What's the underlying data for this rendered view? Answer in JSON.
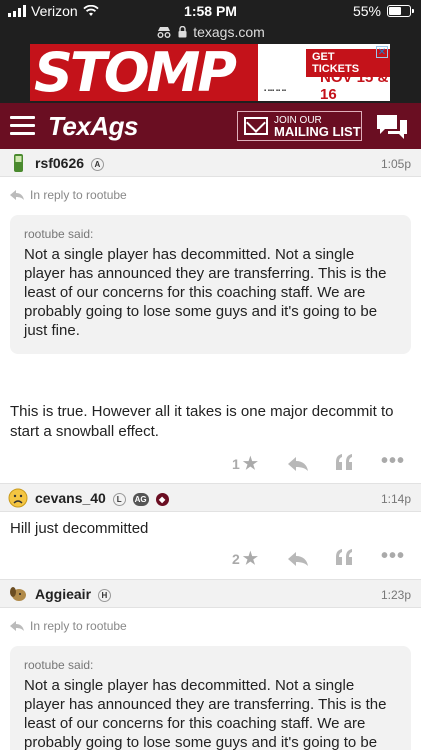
{
  "status_bar": {
    "carrier": "Verizon",
    "time": "1:58 PM",
    "battery_percent": "55%",
    "battery_level": 0.55
  },
  "url_bar": {
    "url": "texags.com"
  },
  "ad": {
    "headline": "STOMP",
    "button_label": "GET TICKETS",
    "dates": "NOV 15 & 16"
  },
  "header": {
    "logo": "TexAgs",
    "mail_small": "JOIN OUR",
    "mail_big": "MAILING LIST",
    "colors": {
      "maroon": "#6a0e22"
    }
  },
  "posts": [
    {
      "username": "rsf0626",
      "badges": [
        "A"
      ],
      "time": "1:05p",
      "reply_to": "In reply to rootube",
      "quote_author": "rootube said:",
      "quote_text": "Not a single player has decommitted. Not a single player has announced they are transferring. This is the least of our concerns for this coaching staff. We are probably going to lose some guys and it's going to be just fine.",
      "body": "This is true. However all it takes is one major decommit to start a snowball effect.",
      "stars": "1"
    },
    {
      "username": "cevans_40",
      "badges": [
        "L",
        "AG"
      ],
      "time": "1:14p",
      "body": "Hill just decommitted",
      "stars": "2"
    },
    {
      "username": "Aggieair",
      "badges": [
        "H"
      ],
      "time": "1:23p",
      "reply_to": "In reply to rootube",
      "quote_author": "rootube said:",
      "quote_text": "Not a single player has decommitted. Not a single player has announced they are transferring. This is the least of our concerns for this coaching staff. We are probably going to lose some guys and it's going to be"
    }
  ]
}
